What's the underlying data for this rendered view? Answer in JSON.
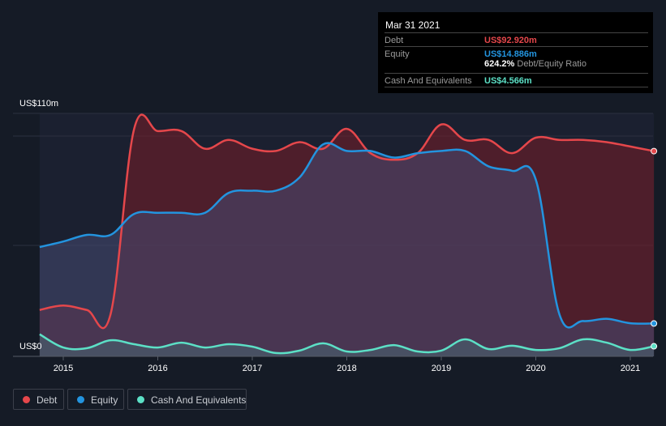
{
  "chart_data": {
    "type": "area",
    "title": "",
    "xlabel": "",
    "ylabel": "",
    "ylim": [
      0,
      110
    ],
    "y_tick_labels": [
      "US$0",
      "US$110m"
    ],
    "x_ticks": [
      2015,
      2016,
      2017,
      2018,
      2019,
      2020,
      2021
    ],
    "x_tick_labels": [
      "2015",
      "2016",
      "2017",
      "2018",
      "2019",
      "2020",
      "2021"
    ],
    "grid": true,
    "legend_position": "bottom-left",
    "x": [
      2014.75,
      2015.0,
      2015.25,
      2015.5,
      2015.75,
      2016.0,
      2016.25,
      2016.5,
      2016.75,
      2017.0,
      2017.25,
      2017.5,
      2017.75,
      2018.0,
      2018.25,
      2018.5,
      2018.75,
      2019.0,
      2019.25,
      2019.5,
      2019.75,
      2020.0,
      2020.25,
      2020.5,
      2020.75,
      2021.0,
      2021.25
    ],
    "series": [
      {
        "name": "Debt",
        "color": "#e5474b",
        "values": [
          21,
          23,
          21,
          19,
          103,
          102,
          102,
          94,
          98,
          94,
          93,
          97,
          94,
          103,
          92,
          89,
          92,
          105,
          98,
          98,
          92,
          99,
          98,
          98,
          97,
          95,
          92.92
        ]
      },
      {
        "name": "Equity",
        "color": "#2394df",
        "values": [
          49.5,
          52,
          55,
          55,
          64.5,
          65,
          65,
          65,
          74,
          75,
          75,
          81,
          96,
          93,
          93,
          90,
          92,
          93,
          93,
          86,
          84,
          80,
          19,
          16,
          17,
          15,
          14.886
        ]
      },
      {
        "name": "Cash And Equivalents",
        "color": "#5ce0c6",
        "values": [
          10,
          4,
          3.7,
          7.3,
          5.5,
          4,
          6.2,
          4,
          5.5,
          4.4,
          1.5,
          2.6,
          5.9,
          2.2,
          2.9,
          5.1,
          2.2,
          2.6,
          7.7,
          3.3,
          4.8,
          2.9,
          3.7,
          7.7,
          6.2,
          2.9,
          4.566
        ]
      }
    ]
  },
  "tooltip": {
    "date": "Mar 31 2021",
    "rows": [
      {
        "label": "Debt",
        "value": "US$92.920m",
        "color": "#e5474b"
      },
      {
        "label": "Equity",
        "value": "US$14.886m",
        "color": "#2394df"
      },
      {
        "label": "Cash And Equivalents",
        "value": "US$4.566m",
        "color": "#5ce0c6"
      }
    ],
    "ratio_value": "624.2%",
    "ratio_label": "Debt/Equity Ratio"
  },
  "legend": [
    {
      "label": "Debt",
      "color": "#e5474b"
    },
    {
      "label": "Equity",
      "color": "#2394df"
    },
    {
      "label": "Cash And Equivalents",
      "color": "#5ce0c6"
    }
  ]
}
